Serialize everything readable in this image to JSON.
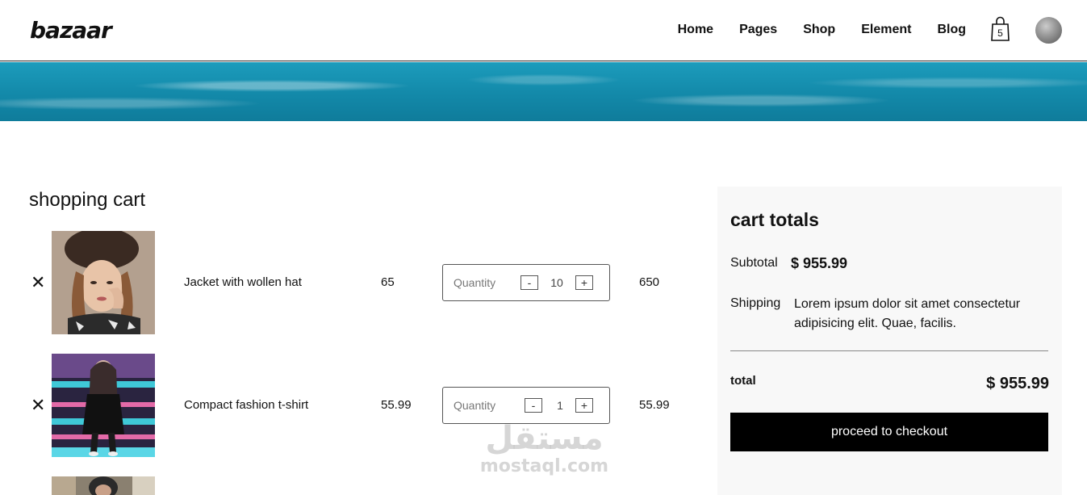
{
  "brand": {
    "logo": "bazaar"
  },
  "nav": {
    "items": [
      "Home",
      "Pages",
      "Shop",
      "Element",
      "Blog"
    ]
  },
  "cart_count": "5",
  "cart": {
    "title": "shopping cart",
    "remove_glyph": "✕",
    "quantity_label": "Quantity",
    "minus": "-",
    "plus": "+",
    "items": [
      {
        "name": "Jacket with wollen hat",
        "price": "65",
        "quantity": "10",
        "subtotal": "650"
      },
      {
        "name": "Compact fashion t-shirt",
        "price": "55.99",
        "quantity": "1",
        "subtotal": "55.99"
      }
    ]
  },
  "totals": {
    "title": "cart totals",
    "subtotal_label": "Subtotal",
    "subtotal_value": "$ 955.99",
    "shipping_label": "Shipping",
    "shipping_text": "Lorem ipsum dolor sit amet consectetur adipisicing elit. Quae, facilis.",
    "total_label": "total",
    "total_value": "$ 955.99",
    "checkout_label": "proceed to checkout"
  },
  "watermark": {
    "arabic": "مستقل",
    "latin": "mostaql.com"
  }
}
